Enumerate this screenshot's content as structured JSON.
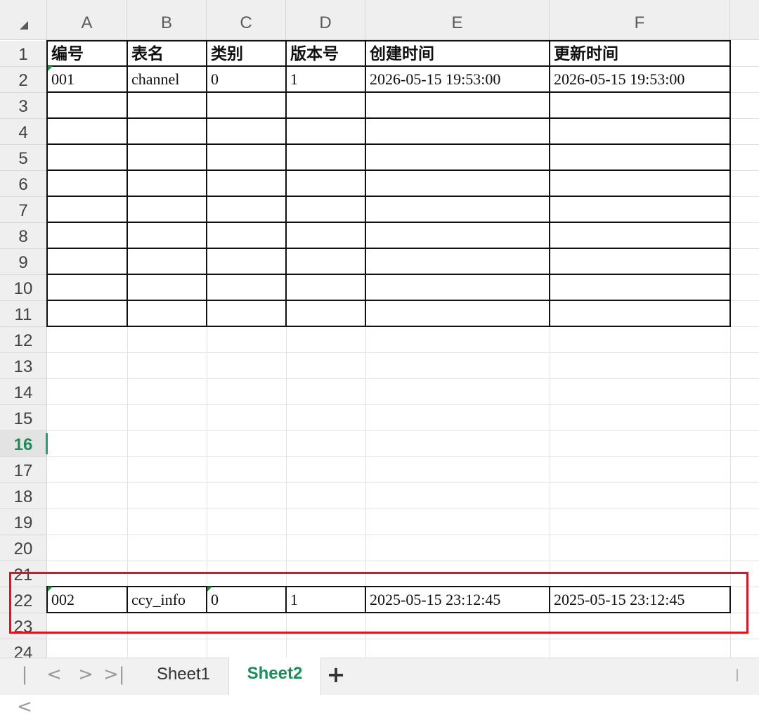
{
  "spreadsheet": {
    "columns": [
      "A",
      "B",
      "C",
      "D",
      "E",
      "F"
    ],
    "rows": [
      "1",
      "2",
      "3",
      "4",
      "5",
      "6",
      "7",
      "8",
      "9",
      "10",
      "11",
      "12",
      "13",
      "14",
      "15",
      "16",
      "17",
      "18",
      "19",
      "20",
      "21",
      "22",
      "23",
      "24"
    ],
    "active_row": "16",
    "table1": {
      "header": [
        "编号",
        "表名",
        "类别",
        "版本号",
        "创建时间",
        "更新时间"
      ],
      "row": [
        "001",
        "channel",
        "0",
        "1",
        "2026-05-15 19:53:00",
        "2026-05-15 19:53:00"
      ]
    },
    "table2": {
      "row": [
        "002",
        "ccy_info",
        "0",
        "1",
        "2025-05-15 23:12:45",
        "2025-05-15 23:12:45"
      ]
    },
    "highlight_color": "#e0141e",
    "accent_color": "#1e8c58"
  },
  "tabs": {
    "sheets": [
      "Sheet1",
      "Sheet2"
    ],
    "active": "Sheet2",
    "nav_first": "|<",
    "nav_prev": "<",
    "nav_next": ">",
    "nav_last": ">|",
    "add": "+"
  }
}
